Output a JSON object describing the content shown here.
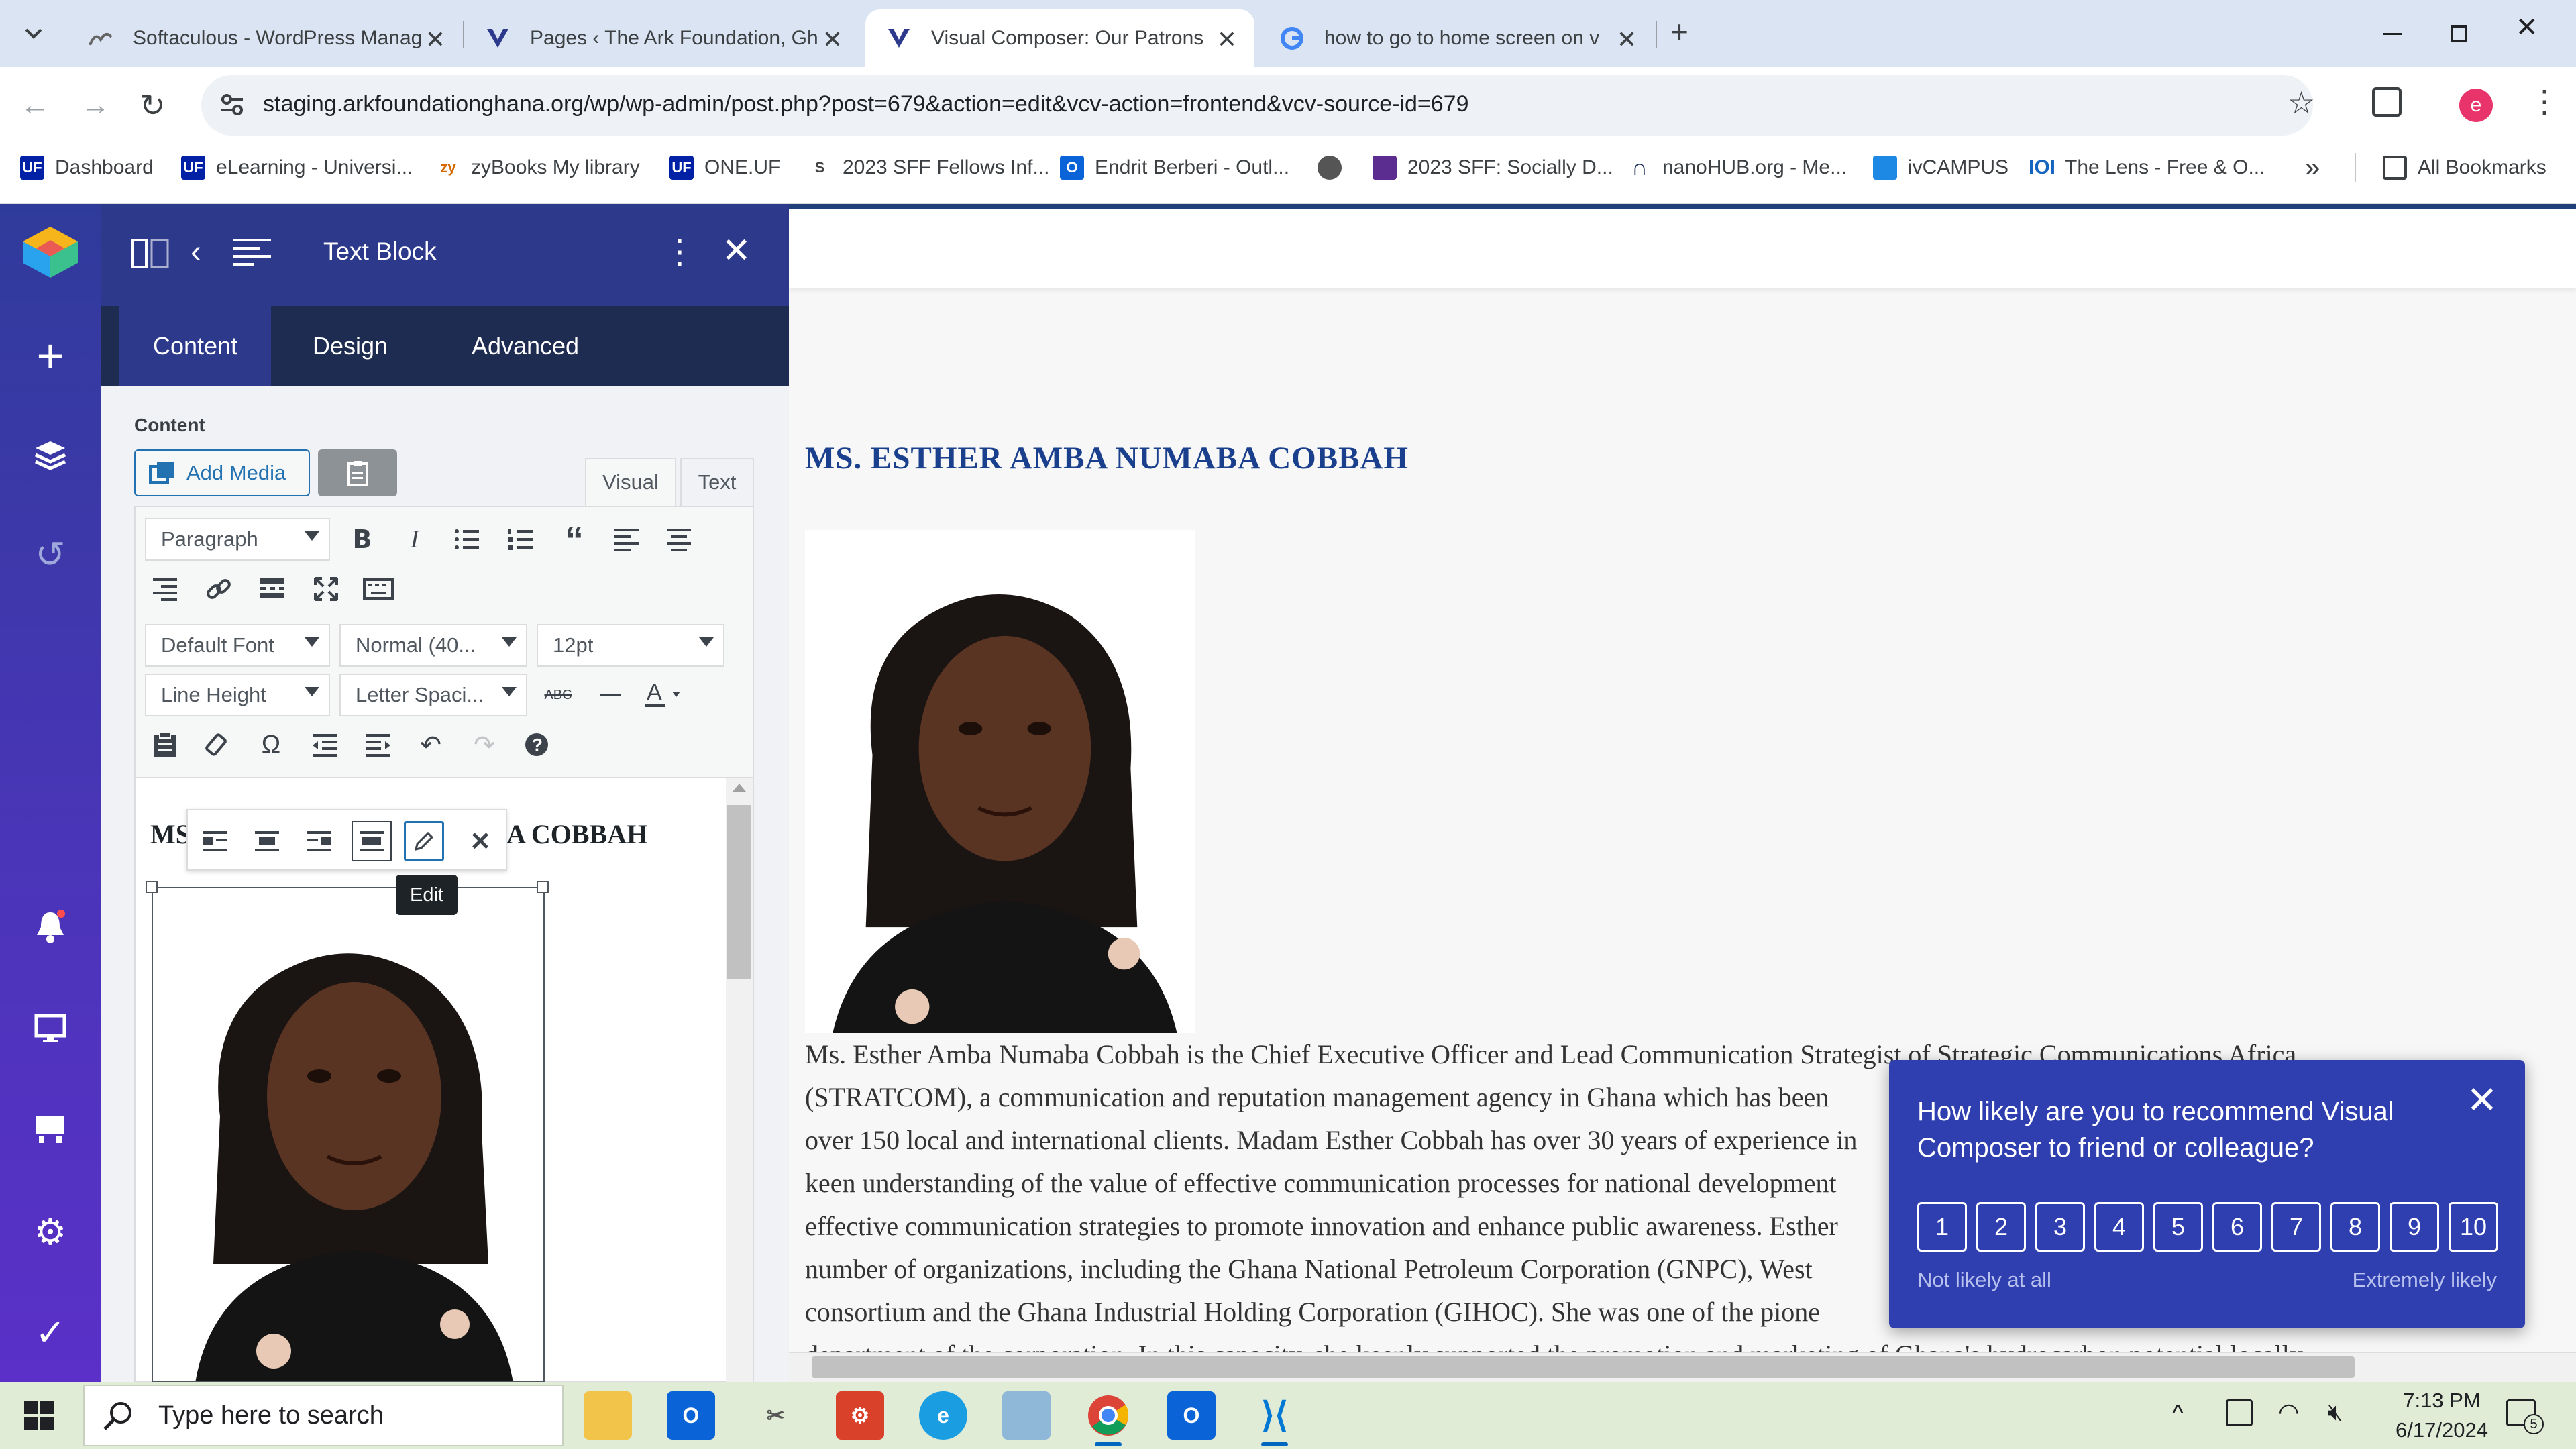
{
  "browser": {
    "tabs": [
      {
        "title": "Softaculous - WordPress Manag",
        "active": false
      },
      {
        "title": "Pages ‹ The Ark Foundation, Gh",
        "active": false
      },
      {
        "title": "Visual Composer: Our Patrons",
        "active": true
      },
      {
        "title": "how to go to home screen on v",
        "active": false
      }
    ],
    "new_tab": "+",
    "url": "staging.arkfoundationghana.org/wp/wp-admin/post.php?post=679&action=edit&vcv-action=frontend&vcv-source-id=679",
    "profile_initial": "e",
    "bookmarks": [
      {
        "label": "Dashboard",
        "icon": "UF",
        "color": "#0021a5"
      },
      {
        "label": "eLearning - Universi...",
        "icon": "UF",
        "color": "#0021a5"
      },
      {
        "label": "zyBooks My library",
        "icon": "zy",
        "color": "#d66a00"
      },
      {
        "label": "ONE.UF",
        "icon": "UF",
        "color": "#0021a5"
      },
      {
        "label": "2023 SFF Fellows Inf...",
        "icon": "S",
        "color": "#444444"
      },
      {
        "label": "Endrit Berberi - Outl...",
        "icon": "O",
        "color": "#0a64d8"
      },
      {
        "label": "",
        "icon": "●",
        "color": "#555555"
      },
      {
        "label": "2023 SFF: Socially D...",
        "icon": "◆",
        "color": "#5c2d91"
      },
      {
        "label": "nanoHUB.org - Me...",
        "icon": "n",
        "color": "#1a2a5a"
      },
      {
        "label": "ivCAMPUS",
        "icon": "iv",
        "color": "#1e88e5"
      },
      {
        "label": "The Lens - Free & O...",
        "icon": "L",
        "color": "#1565c0"
      }
    ],
    "bookmarks_more": "»",
    "all_bookmarks": "All Bookmarks"
  },
  "editor": {
    "panel_title": "Text Block",
    "tabs": [
      "Content",
      "Design",
      "Advanced"
    ],
    "content_label": "Content",
    "add_media": "Add Media",
    "view_tabs": [
      "Visual",
      "Text"
    ],
    "format_select": "Paragraph",
    "font_select": "Default Font",
    "weight_select": "Normal (40...",
    "size_select": "12pt",
    "lineheight_select": "Line Height",
    "letterspacing_select": "Letter Spaci...",
    "heading_text": "MS. ESTHER AMBA NUMABA COBBAH",
    "tooltip": "Edit"
  },
  "preview": {
    "heading": "MS. ESTHER AMBA NUMABA COBBAH",
    "paragraph_lines": [
      "Ms. Esther Amba Numaba Cobbah is the Chief Executive Officer and Lead Communication Strategist of Strategic Communications Africa",
      "(STRATCOM), a communication and reputation management agency in Ghana which has been",
      "over 150 local and international clients. Madam Esther Cobbah has over 30 years of experience in",
      "keen understanding of the value of effective communication processes for national development",
      "effective communication strategies to promote innovation and enhance public awareness. Esther",
      "number of organizations, including the Ghana National Petroleum Corporation (GNPC), West",
      "consortium and the Ghana Industrial Holding Corporation (GIHOC). She was one of the pione",
      "department of the corporation. In this capacity, she keenly supported the promotion and marketing of Ghana's hydrocarbon potential locally"
    ]
  },
  "nps": {
    "question": "How likely are you to recommend Visual Composer to friend or colleague?",
    "scores": [
      "1",
      "2",
      "3",
      "4",
      "5",
      "6",
      "7",
      "8",
      "9",
      "10"
    ],
    "low_label": "Not likely at all",
    "high_label": "Extremely likely"
  },
  "taskbar": {
    "search_placeholder": "Type here to search",
    "time": "7:13 PM",
    "date": "6/17/2024",
    "notification_count": "5"
  },
  "colors": {
    "vc_rail": "#3a37a8",
    "vc_header": "#2d3a8c",
    "nps_bg": "#2f3fb0",
    "heading_blue": "#1a3f8c"
  }
}
